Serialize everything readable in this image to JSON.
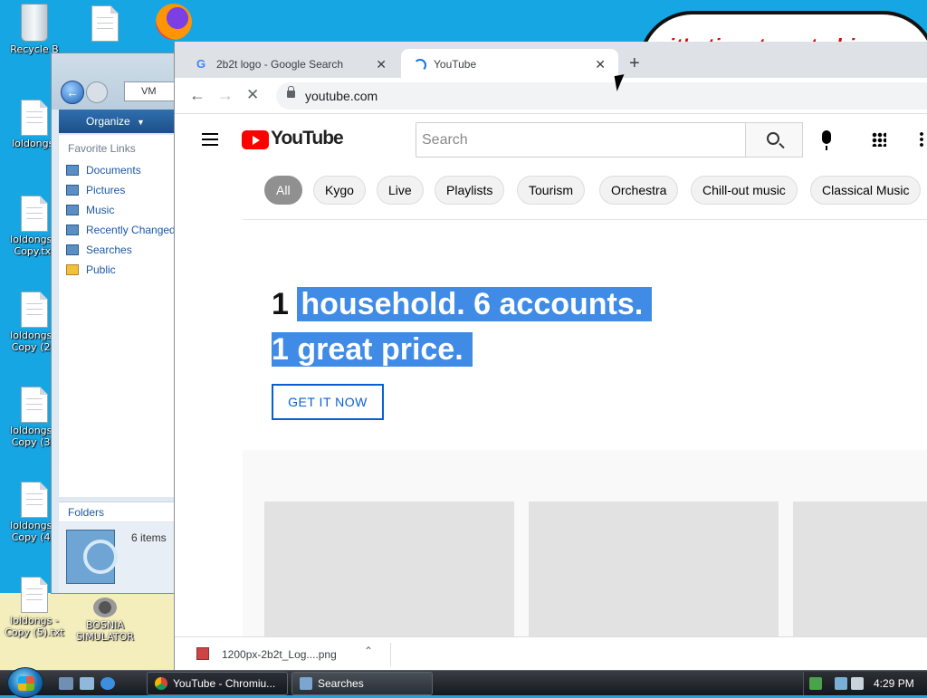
{
  "desktop": {
    "icons": [
      {
        "label": "Recycle B"
      },
      {
        "label": ""
      },
      {
        "label": "loldongs."
      },
      {
        "label": "loldongs - Copy.txt"
      },
      {
        "label": "loldongs - Copy (2)."
      },
      {
        "label": "loldongs - Copy (3)."
      },
      {
        "label": "loldongs - Copy (4)."
      },
      {
        "label": "loldongs - Copy (5).txt"
      },
      {
        "label": "BOSNIA SIMULATOR"
      }
    ],
    "wallpaper_text": "it's time to get chi"
  },
  "explorer": {
    "address": "VM",
    "organize_label": "Organize",
    "favorite_links_heading": "Favorite Links",
    "links": [
      "Documents",
      "Pictures",
      "Music",
      "Recently Changed",
      "Searches",
      "Public"
    ],
    "folders_label": "Folders",
    "status_count": "6 items"
  },
  "browser": {
    "tabs": [
      {
        "title": "2b2t logo - Google Search",
        "favicon": "google-g-icon"
      },
      {
        "title": "YouTube",
        "favicon": "loading-spinner-icon"
      }
    ],
    "url": "youtube.com",
    "downloads": [
      {
        "name": "1200px-2b2t_Log....png"
      }
    ]
  },
  "youtube": {
    "logo_text": "YouTube",
    "search_placeholder": "Search",
    "chips": [
      "All",
      "Kygo",
      "Live",
      "Playlists",
      "Tourism",
      "Orchestra",
      "Chill-out music",
      "Classical Music"
    ],
    "promo": {
      "number": "1",
      "line1": "household. 6 accounts.",
      "line2": "1 great price.",
      "cta": "GET IT NOW"
    }
  },
  "taskbar": {
    "buttons": [
      {
        "label": "YouTube - Chromiu...",
        "icon": "chrome-icon"
      },
      {
        "label": "Searches",
        "icon": "folder-search-icon"
      }
    ],
    "clock": "4:29 PM"
  },
  "colors": {
    "desktop_bg": "#17a6e4",
    "youtube_red": "#ff0000",
    "selection_blue": "#3f8be6",
    "cta_blue": "#065fd4"
  }
}
